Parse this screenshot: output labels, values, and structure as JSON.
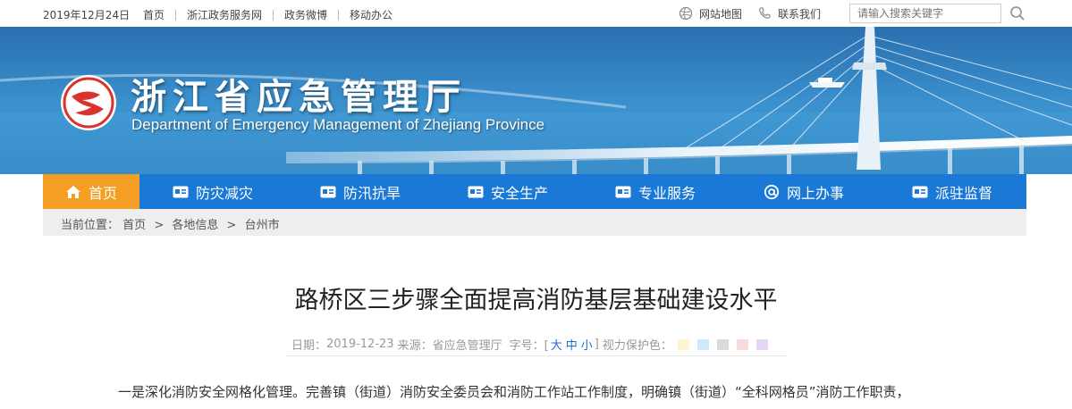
{
  "topbar": {
    "date": "2019年12月24日",
    "links": [
      "首页",
      "浙江政务服务网",
      "政务微博",
      "移动办公"
    ],
    "sitemap_label": "网站地图",
    "contact_label": "联系我们",
    "search_placeholder": "请输入搜索关键字",
    "icons": {
      "sitemap": "globe-icon",
      "contact": "phone-icon",
      "search": "search-icon"
    }
  },
  "header": {
    "title_cn": "浙江省应急管理厅",
    "title_en": "Department of Emergency Management of Zhejiang Province"
  },
  "nav": {
    "items": [
      {
        "label": "首页",
        "icon": "home-icon"
      },
      {
        "label": "防灾减灾",
        "icon": "card-icon"
      },
      {
        "label": "防汛抗旱",
        "icon": "card-icon"
      },
      {
        "label": "安全生产",
        "icon": "card-icon"
      },
      {
        "label": "专业服务",
        "icon": "card-icon"
      },
      {
        "label": "网上办事",
        "icon": "at-icon"
      },
      {
        "label": "派驻监督",
        "icon": "card-icon"
      }
    ],
    "active_color": "#f49e23",
    "bar_color": "#1a78d6"
  },
  "breadcrumb": {
    "prefix": "当前位置：",
    "items": [
      "首页",
      "各地信息",
      "台州市"
    ],
    "separator": ">"
  },
  "article": {
    "title": "路桥区三步骤全面提高消防基层基础建设水平",
    "meta": {
      "date_label": "日期：",
      "date": "2019-12-23",
      "source_label": "来源：",
      "source": "省应急管理厅",
      "font_label": "字号：[",
      "size_large": "大",
      "size_medium": "中",
      "size_small": "小",
      "font_close": "]",
      "eye_label": "视力保护色：",
      "eye_colors": [
        "#fbf6cf",
        "#cfe9f8",
        "#dadada",
        "#f7dada",
        "#e5d6f3"
      ]
    },
    "paragraph": "一是深化消防安全网格化管理。完善镇（街道）消防安全委员会和消防工作站工作制度，明确镇（街道）“全科网格员”消防工作职责，"
  }
}
